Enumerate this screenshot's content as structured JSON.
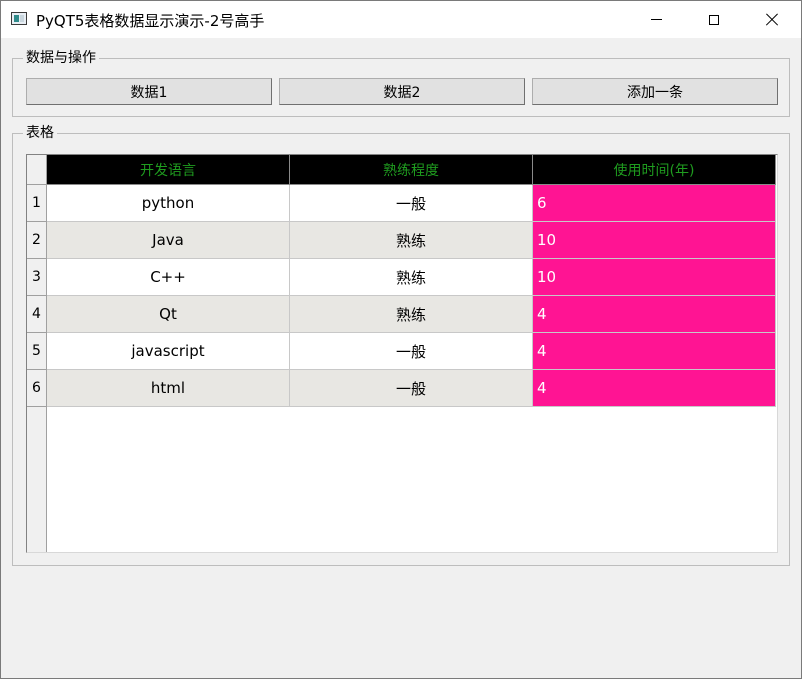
{
  "window": {
    "title": "PyQT5表格数据显示演示-2号高手"
  },
  "group_ops": {
    "title": "数据与操作",
    "buttons": [
      "数据1",
      "数据2",
      "添加一条"
    ]
  },
  "group_table": {
    "title": "表格"
  },
  "table": {
    "headers": [
      "开发语言",
      "熟练程度",
      "使用时间(年)"
    ],
    "header_bg": "#000000",
    "header_fg": "#1f9c1f",
    "highlight_col_bg": "#ff1493",
    "row_numbers": [
      "1",
      "2",
      "3",
      "4",
      "5",
      "6"
    ],
    "rows": [
      [
        "python",
        "一般",
        "6"
      ],
      [
        "Java",
        "熟练",
        "10"
      ],
      [
        "C++",
        "熟练",
        "10"
      ],
      [
        "Qt",
        "熟练",
        "4"
      ],
      [
        "javascript",
        "一般",
        "4"
      ],
      [
        "html",
        "一般",
        "4"
      ]
    ]
  }
}
